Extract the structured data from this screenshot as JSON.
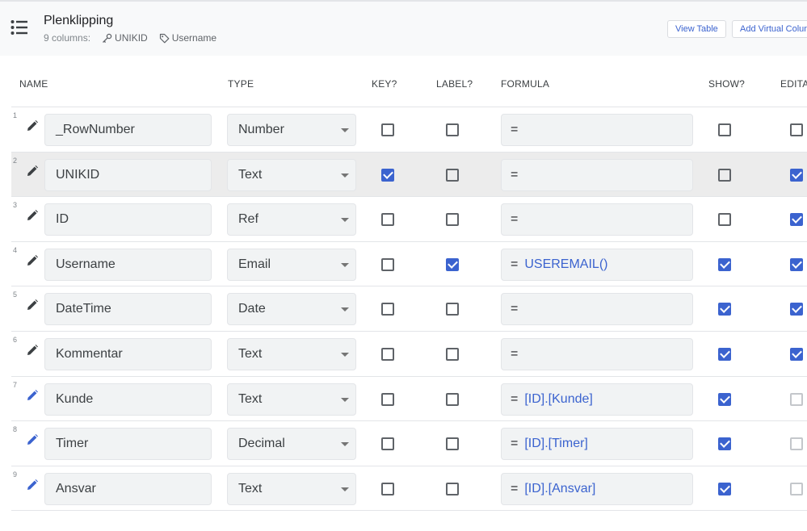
{
  "header": {
    "title": "Plenklipping",
    "columns_count": "9 columns:",
    "key_column": "UNIKID",
    "label_column": "Username",
    "view_table_label": "View Table",
    "add_virtual_label": "Add Virtual Column"
  },
  "columns": {
    "name": "NAME",
    "type": "TYPE",
    "key": "KEY?",
    "label": "LABEL?",
    "formula": "FORMULA",
    "show": "SHOW?",
    "editable": "EDITABLE?"
  },
  "colors": {
    "accent": "#3b63cf",
    "header_bg": "#f8f9fa",
    "field_bg": "#f1f3f4",
    "selected_row": "#ececec"
  },
  "rows": [
    {
      "num": "1",
      "name": "_RowNumber",
      "type": "Number",
      "key": false,
      "label": false,
      "formula_eq": "=",
      "formula": "",
      "show": false,
      "editable": false,
      "editable_disabled": false,
      "virtual": false
    },
    {
      "num": "2",
      "name": "UNIKID",
      "type": "Text",
      "key": true,
      "label": false,
      "formula_eq": "=",
      "formula": "",
      "show": false,
      "editable": true,
      "editable_disabled": false,
      "virtual": false
    },
    {
      "num": "3",
      "name": "ID",
      "type": "Ref",
      "key": false,
      "label": false,
      "formula_eq": "=",
      "formula": "",
      "show": false,
      "editable": true,
      "editable_disabled": false,
      "virtual": false
    },
    {
      "num": "4",
      "name": "Username",
      "type": "Email",
      "key": false,
      "label": true,
      "formula_eq": "=",
      "formula": "USEREMAIL()",
      "show": true,
      "editable": true,
      "editable_disabled": false,
      "virtual": false
    },
    {
      "num": "5",
      "name": "DateTime",
      "type": "Date",
      "key": false,
      "label": false,
      "formula_eq": "=",
      "formula": "",
      "show": true,
      "editable": true,
      "editable_disabled": false,
      "virtual": false
    },
    {
      "num": "6",
      "name": "Kommentar",
      "type": "Text",
      "key": false,
      "label": false,
      "formula_eq": "=",
      "formula": "",
      "show": true,
      "editable": true,
      "editable_disabled": false,
      "virtual": false
    },
    {
      "num": "7",
      "name": "Kunde",
      "type": "Text",
      "key": false,
      "label": false,
      "formula_eq": "=",
      "formula": "[ID].[Kunde]",
      "show": true,
      "editable": false,
      "editable_disabled": true,
      "virtual": true
    },
    {
      "num": "8",
      "name": "Timer",
      "type": "Decimal",
      "key": false,
      "label": false,
      "formula_eq": "=",
      "formula": "[ID].[Timer]",
      "show": true,
      "editable": false,
      "editable_disabled": true,
      "virtual": true
    },
    {
      "num": "9",
      "name": "Ansvar",
      "type": "Text",
      "key": false,
      "label": false,
      "formula_eq": "=",
      "formula": "[ID].[Ansvar]",
      "show": true,
      "editable": false,
      "editable_disabled": true,
      "virtual": true
    }
  ]
}
